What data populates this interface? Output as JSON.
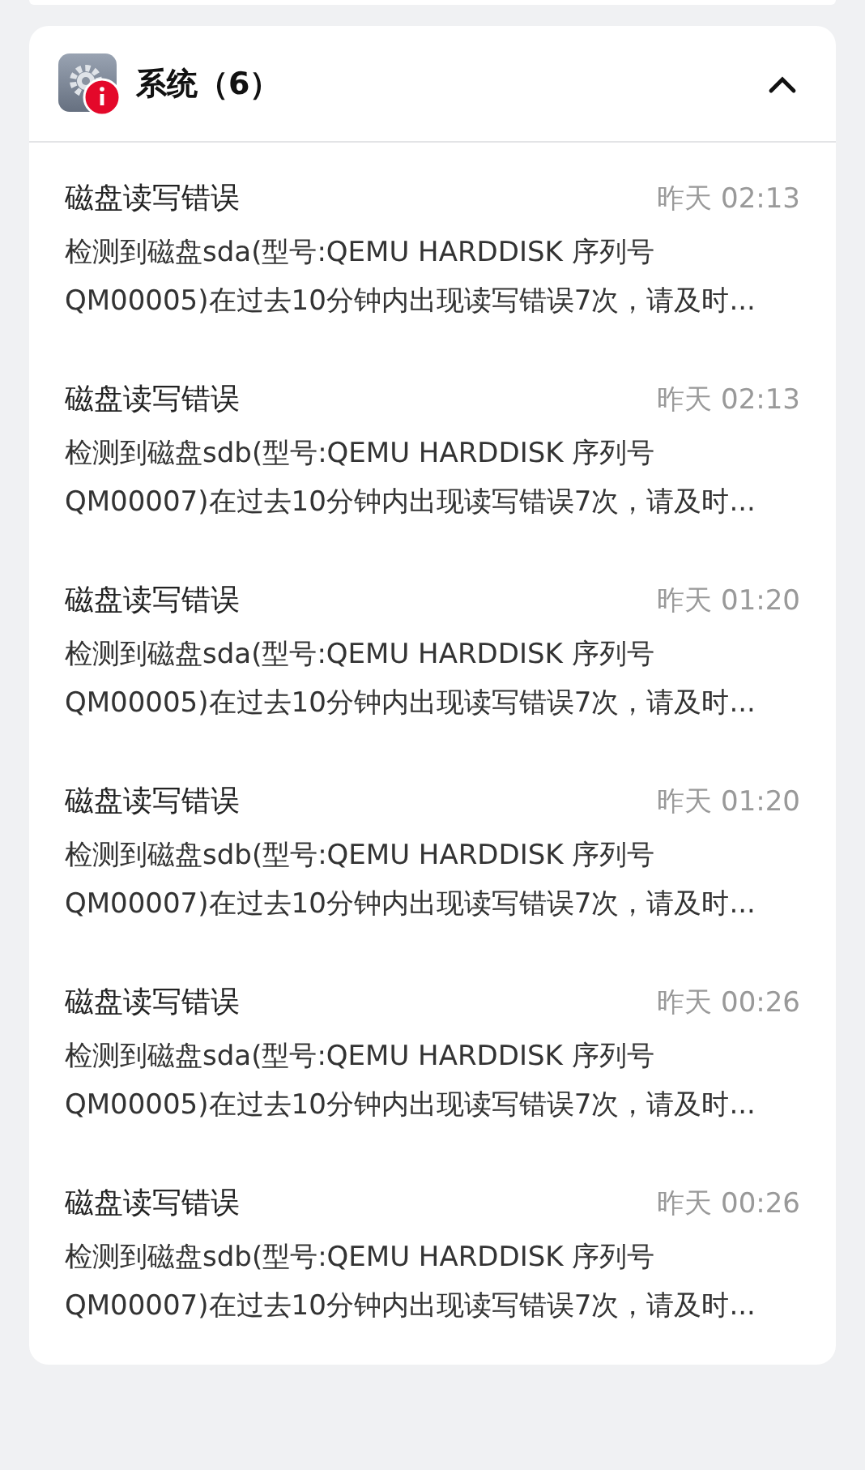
{
  "section": {
    "title": "系统（6）",
    "expanded": true,
    "notifications": [
      {
        "title": "磁盘读写错误",
        "time": "昨天 02:13",
        "lines": [
          "检测到磁盘sda(型号:QEMU HARDDISK 序列号",
          "QM00005)在过去10分钟内出现读写错误7次，请及时..."
        ]
      },
      {
        "title": "磁盘读写错误",
        "time": "昨天 02:13",
        "lines": [
          "检测到磁盘sdb(型号:QEMU HARDDISK 序列号",
          "QM00007)在过去10分钟内出现读写错误7次，请及时..."
        ]
      },
      {
        "title": "磁盘读写错误",
        "time": "昨天 01:20",
        "lines": [
          "检测到磁盘sda(型号:QEMU HARDDISK 序列号",
          "QM00005)在过去10分钟内出现读写错误7次，请及时..."
        ]
      },
      {
        "title": "磁盘读写错误",
        "time": "昨天 01:20",
        "lines": [
          "检测到磁盘sdb(型号:QEMU HARDDISK 序列号",
          "QM00007)在过去10分钟内出现读写错误7次，请及时..."
        ]
      },
      {
        "title": "磁盘读写错误",
        "time": "昨天 00:26",
        "lines": [
          "检测到磁盘sda(型号:QEMU HARDDISK 序列号",
          "QM00005)在过去10分钟内出现读写错误7次，请及时..."
        ]
      },
      {
        "title": "磁盘读写错误",
        "time": "昨天 00:26",
        "lines": [
          "检测到磁盘sdb(型号:QEMU HARDDISK 序列号",
          "QM00007)在过去10分钟内出现读写错误7次，请及时..."
        ]
      }
    ]
  }
}
